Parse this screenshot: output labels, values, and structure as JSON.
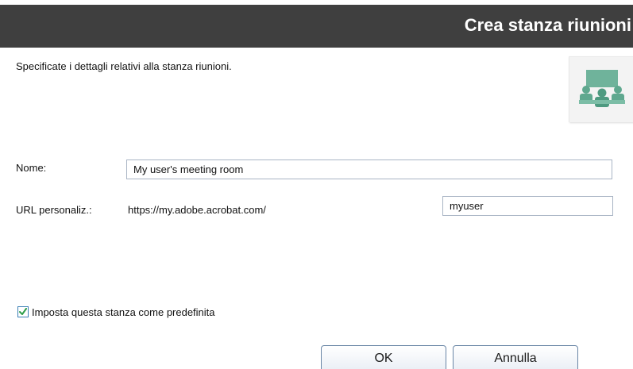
{
  "dialog": {
    "title": "Crea stanza riunioni",
    "instructions": "Specificate i dettagli relativi alla stanza riunioni.",
    "icon": "meeting-room-icon"
  },
  "form": {
    "name_label": "Nome:",
    "name_value": "My user's meeting room",
    "url_label": "URL personaliz.:",
    "url_prefix": "https://my.adobe.acrobat.com/",
    "url_value": "myuser",
    "default_checkbox_label": "Imposta questa stanza come predefinita",
    "default_checked": true
  },
  "buttons": {
    "ok_label": "OK",
    "cancel_label": "Annulla"
  },
  "colors": {
    "title_bar": "#3f3f3f",
    "icon_green": "#5fa88f",
    "checkmark": "#2e9e4a"
  }
}
